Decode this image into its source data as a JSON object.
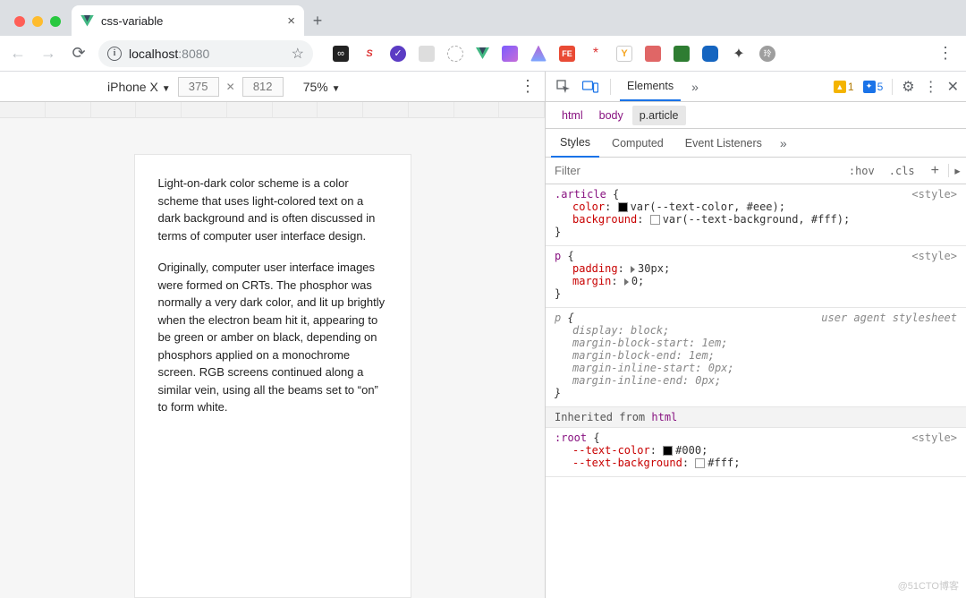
{
  "browser": {
    "tab_title": "css-variable",
    "new_tab_glyph": "+",
    "close_glyph": "×",
    "url_host": "localhost",
    "url_port": ":8080",
    "extensions": [
      "loop",
      "S",
      "check",
      "grid",
      "dot",
      "vue",
      "wave",
      "feather",
      "FE",
      "asterisk",
      "Y",
      "box",
      "sq",
      "globe",
      "puzzle",
      "avatar"
    ]
  },
  "device_toolbar": {
    "device": "iPhone X",
    "width": "375",
    "height": "812",
    "zoom": "75%"
  },
  "page_content": {
    "para1": "Light-on-dark color scheme is a color scheme that uses light-colored text on a dark background and is often discussed in terms of computer user interface design.",
    "para2": "Originally, computer user interface images were formed on CRTs. The phosphor was normally a very dark color, and lit up brightly when the electron beam hit it, appearing to be green or amber on black, depending on phosphors applied on a monochrome screen. RGB screens continued along a similar vein, using all the beams set to “on” to form white."
  },
  "devtools": {
    "tabs": {
      "elements": "Elements"
    },
    "badges": {
      "warn": "1",
      "info": "5"
    },
    "breadcrumb": [
      "html",
      "body",
      "p.article"
    ],
    "subtabs": {
      "styles": "Styles",
      "computed": "Computed",
      "listeners": "Event Listeners"
    },
    "filter": {
      "placeholder": "Filter",
      "hov": ":hov",
      "cls": ".cls"
    },
    "rules": {
      "r1": {
        "selector": ".article",
        "origin": "<style>",
        "p1_name": "color",
        "p1_swatch": "#000",
        "p1_val": "var(--text-color, #eee)",
        "p2_name": "background",
        "p2_swatch": "#fff",
        "p2_val": "var(--text-background, #fff)"
      },
      "r2": {
        "selector": "p",
        "origin": "<style>",
        "p1_name": "padding",
        "p1_val": "30px",
        "p2_name": "margin",
        "p2_val": "0"
      },
      "r3": {
        "selector": "p",
        "origin": "user agent stylesheet",
        "p1_name": "display",
        "p1_val": "block",
        "p2_name": "margin-block-start",
        "p2_val": "1em",
        "p3_name": "margin-block-end",
        "p3_val": "1em",
        "p4_name": "margin-inline-start",
        "p4_val": "0px",
        "p5_name": "margin-inline-end",
        "p5_val": "0px"
      },
      "inherit_label": "Inherited from ",
      "inherit_from": "html",
      "r4": {
        "selector": ":root",
        "origin": "<style>",
        "p1_name": "--text-color",
        "p1_swatch": "#000",
        "p1_val": "#000",
        "p2_name": "--text-background",
        "p2_swatch": "#fff",
        "p2_val": "#fff"
      }
    }
  },
  "watermark": "@51CTO博客"
}
